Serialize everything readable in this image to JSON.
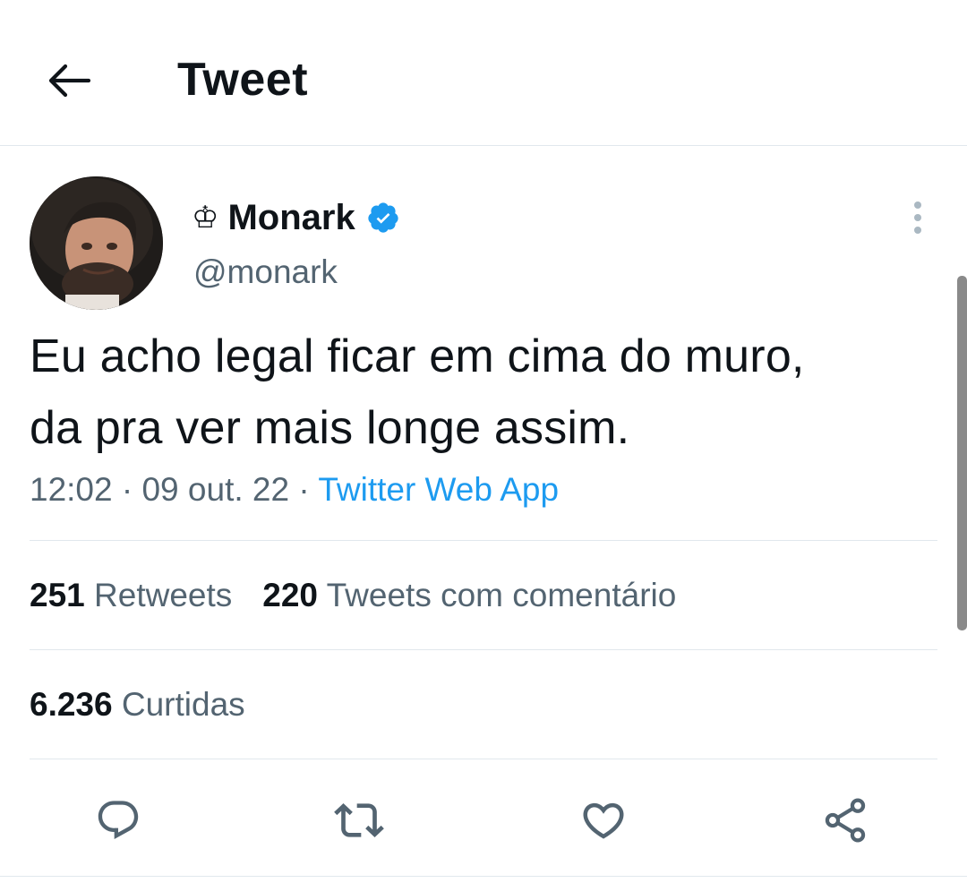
{
  "header": {
    "back_icon": "arrow-left-icon",
    "title": "Tweet"
  },
  "tweet": {
    "author": {
      "crown": "♔",
      "display_name": "Monark",
      "handle": "@monark",
      "verified_icon": "verified-badge-icon",
      "verified_color": "#1d9bf0"
    },
    "text_lines": [
      "Eu acho legal ficar em cima do muro,",
      "da pra ver mais longe assim."
    ],
    "time": "12:02",
    "separator": "·",
    "date": "09 out. 22",
    "source": "Twitter Web App",
    "stats": {
      "retweets_count": "251",
      "retweets_label": "Retweets",
      "quotes_count": "220",
      "quotes_label": "Tweets com comentário",
      "likes_count": "6.236",
      "likes_label": "Curtidas"
    },
    "actions": {
      "reply_icon": "reply-icon",
      "retweet_icon": "retweet-icon",
      "like_icon": "heart-icon",
      "share_icon": "share-icon"
    }
  },
  "colors": {
    "text_primary": "#0f1419",
    "text_secondary": "#536471",
    "link": "#1d9bf0",
    "divider": "#e1e8ed"
  }
}
